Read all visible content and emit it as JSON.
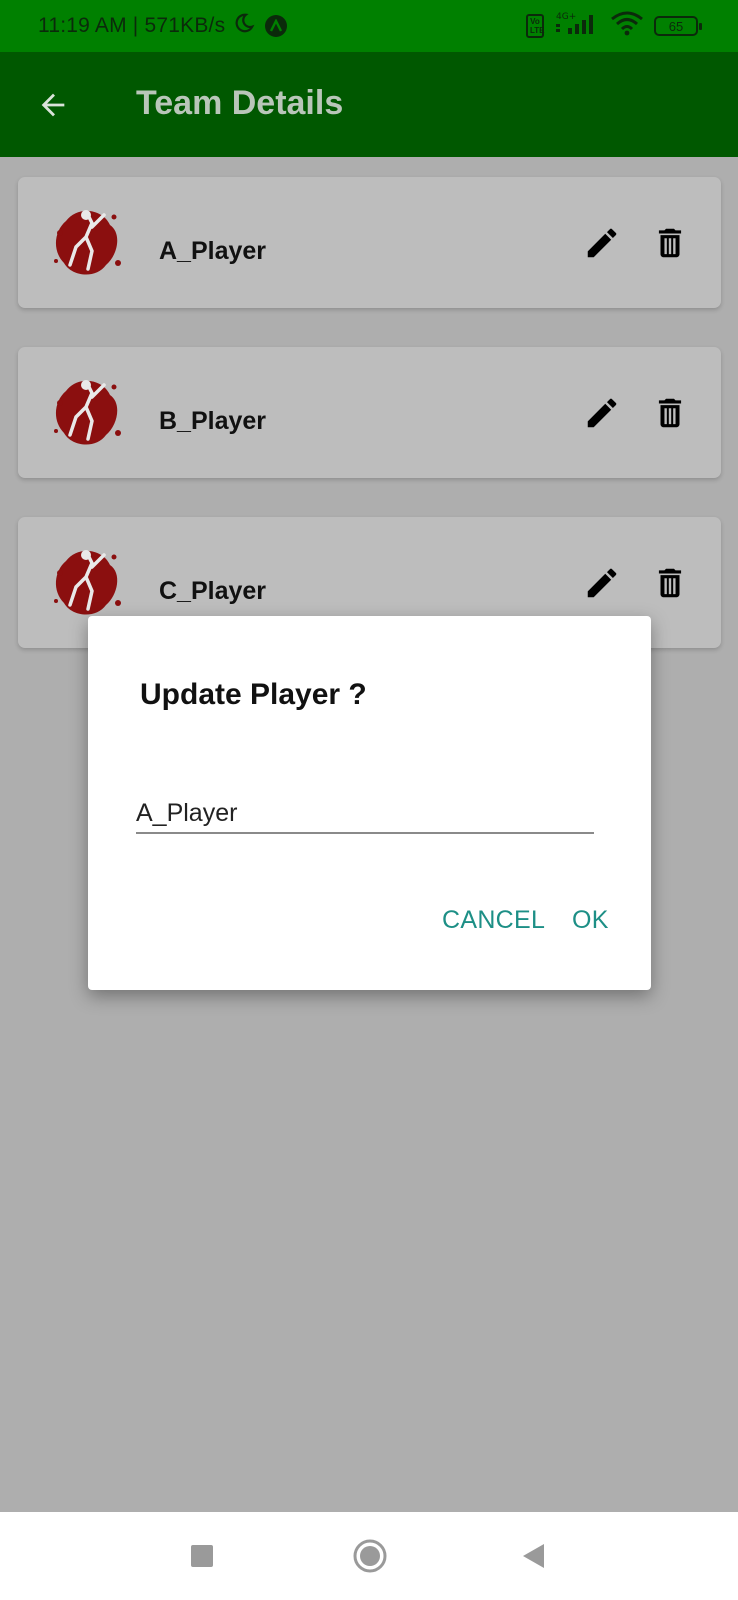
{
  "status_bar": {
    "time_speed": "11:19 AM | 571KB/s",
    "volte_label": "Vo\nLTE",
    "network": "4G+",
    "battery": "65",
    "icons": [
      "moon-icon",
      "app-icon",
      "volte-icon",
      "signal-icon",
      "wifi-icon",
      "battery-icon"
    ]
  },
  "app_bar": {
    "title": "Team Details",
    "back_icon": "arrow-back-icon",
    "color": "#005800"
  },
  "players": [
    {
      "name": "A_Player"
    },
    {
      "name": "B_Player"
    },
    {
      "name": "C_Player"
    }
  ],
  "card_icons": {
    "edit": "pencil-icon",
    "delete": "trash-icon",
    "avatar": "cricketer-icon"
  },
  "dialog": {
    "title": "Update Player ?",
    "input_value": "A_Player",
    "cancel_label": "CANCEL",
    "ok_label": "OK",
    "accent_color": "#1d8f86"
  },
  "nav_bar": {
    "icons": [
      "recent-apps-icon",
      "home-icon",
      "back-icon"
    ]
  },
  "colors": {
    "status_bar": "#008000",
    "scrim": "#aeaeae",
    "card": "#bdbdbd"
  }
}
